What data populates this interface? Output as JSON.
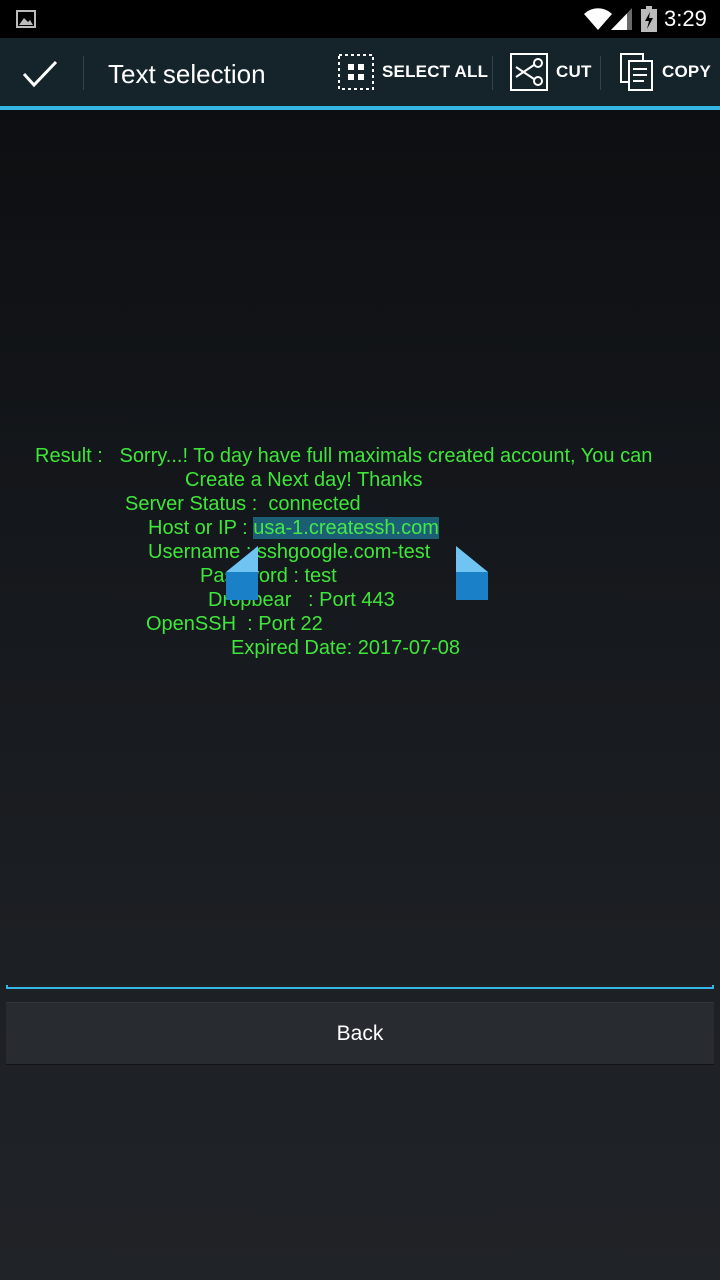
{
  "status_bar": {
    "time": "3:29",
    "icons": [
      "gallery-icon",
      "wifi-icon",
      "signal-icon",
      "battery-charging-icon"
    ]
  },
  "action_bar": {
    "done_icon": "checkmark-icon",
    "title": "Text selection",
    "select_all_label": "SELECT ALL",
    "cut_label": "CUT",
    "copy_label": "COPY",
    "accent_color": "#33b5e5"
  },
  "result": {
    "line1": "Result :   Sorry...! To day have full maximals created account, You can",
    "line2": "Create a Next day! Thanks",
    "line3": "Server Status :  connected",
    "host_label": "Host or IP : ",
    "host_value": "usa-1.createssh.com",
    "username_line": "Username : sshgoogle.com-test",
    "password_line": "Password : test",
    "dropbear_line": "Dropbear   : Port 443",
    "openssh_line": "OpenSSH  : Port 22",
    "expired_line": "Expired Date: 2017-07-08",
    "text_color": "#3fe63a",
    "selection_color": "#1a5f73"
  },
  "back_button": {
    "label": "Back"
  }
}
